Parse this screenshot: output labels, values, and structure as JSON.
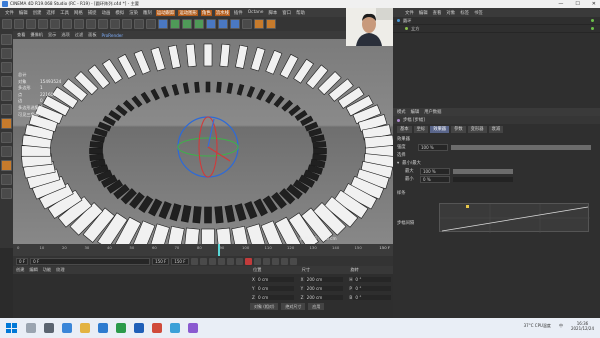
{
  "window": {
    "title": "CINEMA 4D R19.068 Studio (RC - R19) - [圆环阵列.c4d *] - 主要",
    "min": "—",
    "max": "☐",
    "close": "✕"
  },
  "menu": [
    "文件",
    "编辑",
    "创建",
    "选择",
    "工具",
    "网格",
    "捕捉",
    "动画",
    "模拟",
    "渲染",
    "雕刻",
    "运动跟踪",
    "运动图形",
    "角色",
    "流水线",
    "插件",
    "Octane",
    "脚本",
    "窗口",
    "帮助"
  ],
  "menu_highlight": [
    "运动跟踪",
    "运动图形",
    "角色",
    "流水线"
  ],
  "viewport": {
    "menu": [
      "查看",
      "摄像机",
      "显示",
      "选项",
      "过滤",
      "面板",
      "ProRender"
    ],
    "stats": [
      {
        "k": "总计",
        "v": ""
      },
      {
        "k": "对象",
        "v": "15493524"
      },
      {
        "k": "多边形",
        "v": "1"
      },
      {
        "k": "点",
        "v": "22160585"
      },
      {
        "k": "边",
        "v": "0"
      },
      {
        "k": "多边形选集",
        "v": "0"
      },
      {
        "k": "可见三角形",
        "v": "0"
      }
    ],
    "grid_label": "网格间距 : 100 cm"
  },
  "timeline": {
    "ticks": [
      "0",
      "10",
      "20",
      "30",
      "40",
      "50",
      "60",
      "70",
      "80",
      "90",
      "100",
      "110",
      "120",
      "130",
      "140",
      "150"
    ],
    "end_label": "150 F",
    "frame_readout": "0 F"
  },
  "playback": {
    "start": "0 F",
    "min": "0 F",
    "max": "150 F",
    "end": "150 F"
  },
  "object_panel": {
    "tabs": [
      "创建",
      "编辑",
      "功能",
      "纹理"
    ]
  },
  "coords": {
    "headers": [
      "位置",
      "尺寸",
      "旋转"
    ],
    "rows": [
      {
        "a": "X",
        "p": "0 cm",
        "s": "200 cm",
        "rl": "H",
        "r": "0 °"
      },
      {
        "a": "Y",
        "p": "0 cm",
        "s": "200 cm",
        "rl": "P",
        "r": "0 °"
      },
      {
        "a": "Z",
        "p": "0 cm",
        "s": "200 cm",
        "rl": "B",
        "r": "0 °"
      }
    ],
    "mode": "对象 (相对)",
    "size_mode": "绝对尺寸",
    "apply": "应用"
  },
  "object_manager": {
    "menu": [
      "文件",
      "编辑",
      "查看",
      "对象",
      "标签",
      "书签"
    ],
    "items": [
      {
        "name": "圆环",
        "indent": 0
      },
      {
        "name": "立方",
        "indent": 4
      }
    ]
  },
  "attributes": {
    "menu": [
      "模式",
      "编辑",
      "用户数据"
    ],
    "object_title": "步幅 [步幅]",
    "tabs": [
      {
        "label": "基本",
        "on": false
      },
      {
        "label": "坐标",
        "on": false
      },
      {
        "label": "效果器",
        "on": true
      },
      {
        "label": "参数",
        "on": false
      },
      {
        "label": "变形器",
        "on": false
      },
      {
        "label": "衰减",
        "on": false
      }
    ],
    "section": "效果器",
    "strength": {
      "label": "强度",
      "value": "100 %",
      "fill": 1.0
    },
    "selection": {
      "label": "选择"
    },
    "minmax": {
      "label": "最小/最大"
    },
    "max": {
      "label": "最大",
      "value": "100 %",
      "fill": 1.0
    },
    "min": {
      "label": "最小",
      "value": "0 %",
      "fill": 0.0
    },
    "spline_label": "样条",
    "step_gap_label": "步幅间隔"
  },
  "camera_feed": {
    "icon": "webcam-person"
  },
  "taskbar": {
    "weather": "37°C",
    "weather_sub": "CPU温度",
    "time": "16:36",
    "date": "2021/12/24",
    "lang": "中"
  }
}
